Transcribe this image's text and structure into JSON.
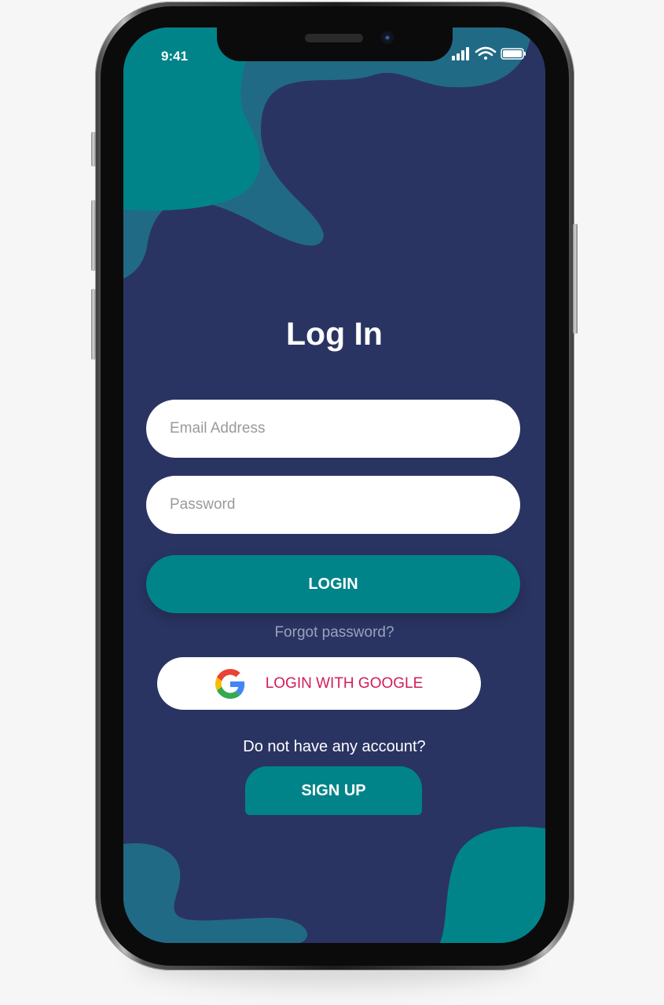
{
  "status_bar": {
    "time": "9:41"
  },
  "login": {
    "title": "Log In",
    "email_placeholder": "Email Address",
    "password_placeholder": "Password",
    "login_label": "LOGIN",
    "forgot_label": "Forgot password?",
    "google_label": "LOGIN WITH GOOGLE",
    "no_account_text": "Do not have any account?",
    "signup_label": "SIGN UP"
  },
  "colors": {
    "background": "#2a3462",
    "accent_teal": "#00848a",
    "google_text": "#d21b5b"
  },
  "icons": [
    "signal-icon",
    "wifi-icon",
    "battery-icon",
    "google-icon"
  ]
}
